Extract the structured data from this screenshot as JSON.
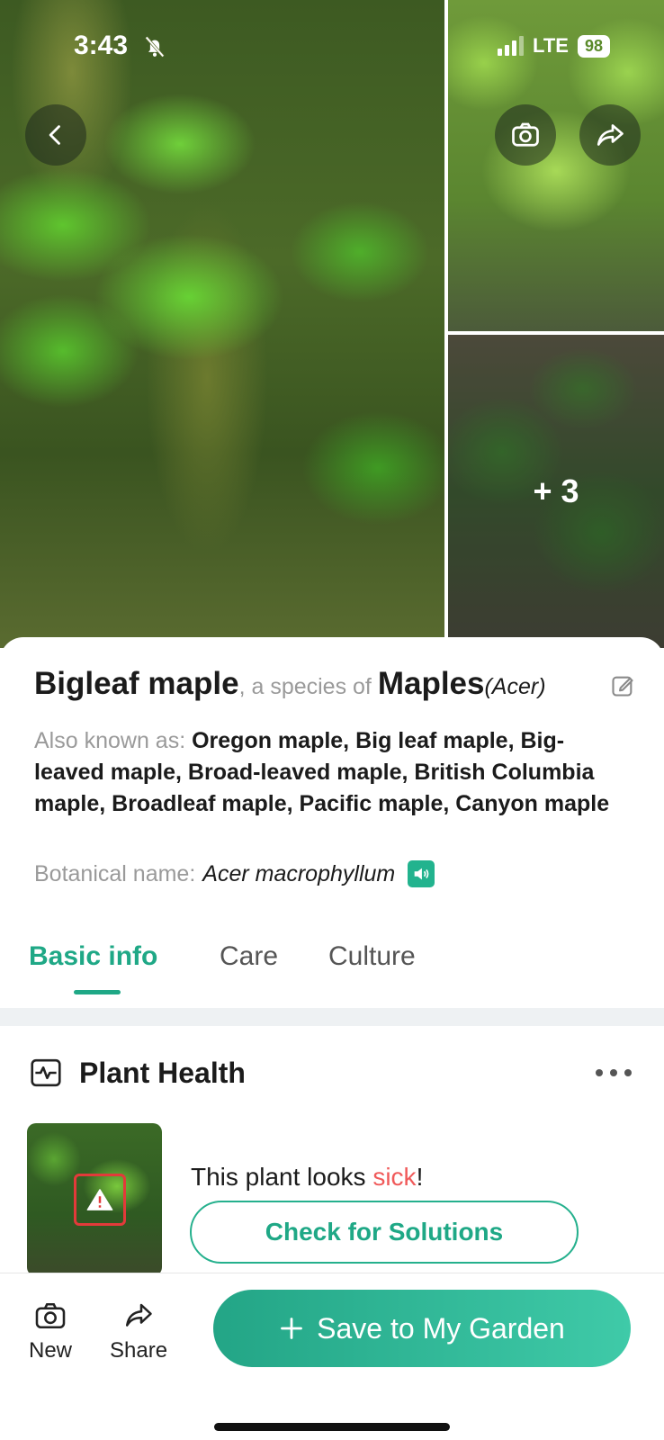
{
  "status_bar": {
    "time": "3:43",
    "network": "LTE",
    "battery": "98",
    "icons": [
      "bell-slash-icon",
      "signal-icon"
    ]
  },
  "photos": {
    "more_count": "+ 3",
    "buttons": [
      "back-icon",
      "camera-icon",
      "share-icon"
    ]
  },
  "plant": {
    "common_name": "Bigleaf maple",
    "species_of_text": ", a species of ",
    "genus": "Maples",
    "genus_latin": "(Acer)",
    "aka_label": "Also known as: ",
    "aka_value": "Oregon maple, Big leaf maple, Big-leaved maple, Broad-leaved maple, British Columbia maple, Broadleaf maple, Pacific maple, Canyon maple",
    "botanical_label": "Botanical name: ",
    "botanical_value": "Acer macrophyllum"
  },
  "tabs": [
    {
      "label": "Basic info",
      "active": true
    },
    {
      "label": "Care",
      "active": false
    },
    {
      "label": "Culture",
      "active": false
    }
  ],
  "health": {
    "title": "Plant Health",
    "status_prefix": "This plant looks ",
    "status_word": "sick",
    "status_suffix": "!",
    "button_label": "Check for Solutions"
  },
  "bottom_bar": {
    "new_label": "New",
    "share_label": "Share",
    "save_label": "Save to My Garden"
  },
  "colors": {
    "accent": "#1fa886",
    "sick": "#f05a5a",
    "warning": "#e23a3a"
  }
}
